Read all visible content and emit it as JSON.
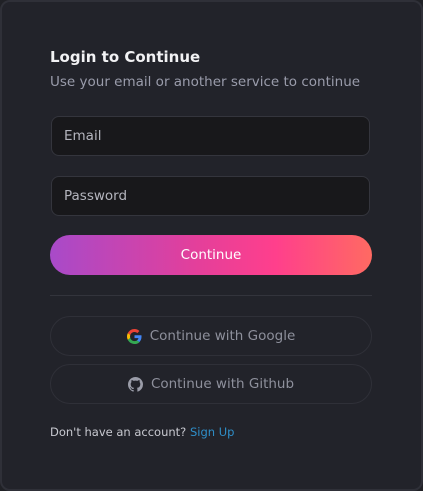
{
  "login": {
    "title": "Login to Continue",
    "subtitle": "Use your email or another service to continue",
    "email": {
      "placeholder": "Email",
      "value": ""
    },
    "password": {
      "placeholder": "Password",
      "value": ""
    },
    "continue_label": "Continue",
    "google_label": "Continue with Google",
    "github_label": "Continue with Github",
    "footer_text": "Don't have an account?",
    "signup_link": "Sign Up"
  },
  "icons": {
    "google": "google-icon",
    "github": "github-icon"
  },
  "colors": {
    "background": "#202126",
    "card": "#22232a",
    "input_bg": "#18181b",
    "link": "#2f8fc9",
    "gradient": [
      "#a84ac9",
      "#e33f9b",
      "#ff3f8c",
      "#ff6a62"
    ]
  }
}
